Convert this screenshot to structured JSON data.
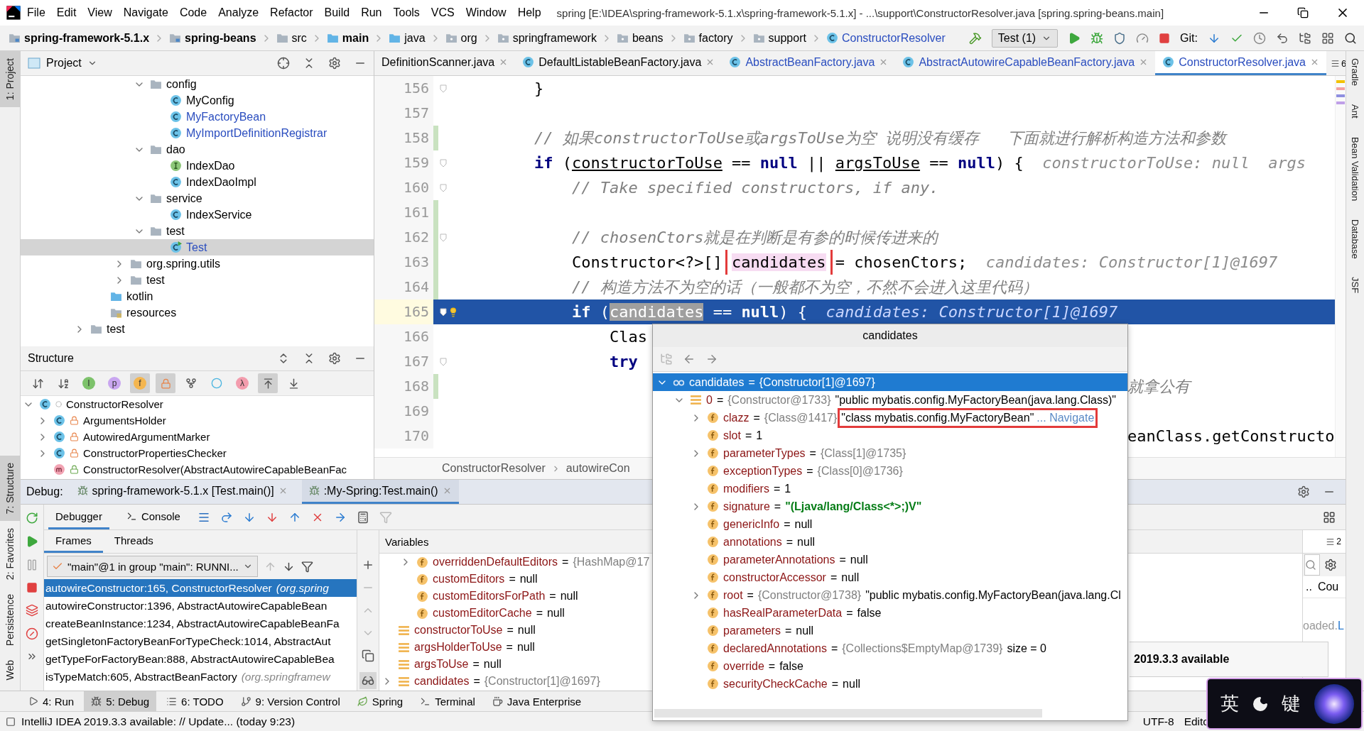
{
  "title_bar": {
    "menu": [
      "File",
      "Edit",
      "View",
      "Navigate",
      "Code",
      "Analyze",
      "Refactor",
      "Build",
      "Run",
      "Tools",
      "VCS",
      "Window",
      "Help"
    ],
    "title": "spring [E:\\IDEA\\spring-framework-5.1.x\\spring-framework-5.1.x] - ...\\support\\ConstructorResolver.java [spring.spring-beans.main]"
  },
  "nav_bar": {
    "path": [
      {
        "label": "spring-framework-5.1.x",
        "kind": "module"
      },
      {
        "label": "spring-beans",
        "kind": "module"
      },
      {
        "label": "src",
        "kind": "folder"
      },
      {
        "label": "main",
        "kind": "source_root"
      },
      {
        "label": "java",
        "kind": "source_folder"
      },
      {
        "label": "org",
        "kind": "package"
      },
      {
        "label": "springframework",
        "kind": "package"
      },
      {
        "label": "beans",
        "kind": "package"
      },
      {
        "label": "factory",
        "kind": "package"
      },
      {
        "label": "support",
        "kind": "package"
      },
      {
        "label": "ConstructorResolver",
        "kind": "class"
      }
    ],
    "run_config": "Test (1)",
    "vcs_label": "Git:"
  },
  "left_tool_strip": [
    {
      "label": "1: Project",
      "selected": true
    },
    {
      "label": "7: Structure",
      "selected": true
    },
    {
      "label": "2: Favorites",
      "selected": false
    },
    {
      "label": "Persistence",
      "selected": false
    },
    {
      "label": "Web",
      "selected": false
    }
  ],
  "right_tool_strip": [
    "Gradle",
    "Ant",
    "Bean Validation",
    "Database",
    "JSF"
  ],
  "project": {
    "title": "Project",
    "tree": [
      {
        "kind": "group",
        "children": [
          {
            "kind": "group",
            "children": [
              {
                "kind": "group",
                "children": [
                  {
                    "label": "config",
                    "kind": "folder",
                    "expanded": true,
                    "selected": false,
                    "color": "#000000",
                    "children": [
                      {
                        "label": "MyConfig",
                        "kind": "class",
                        "selected": false,
                        "color": "#000000"
                      },
                      {
                        "label": "MyFactoryBean",
                        "kind": "class",
                        "selected": false,
                        "color": "#2a4dbf"
                      },
                      {
                        "label": "MyImportDefinitionRegistrar",
                        "kind": "class",
                        "selected": false,
                        "color": "#2a4dbf"
                      }
                    ]
                  },
                  {
                    "label": "dao",
                    "kind": "folder",
                    "expanded": true,
                    "selected": false,
                    "color": "#000000",
                    "children": [
                      {
                        "label": "IndexDao",
                        "kind": "interface",
                        "selected": false,
                        "color": "#000000"
                      },
                      {
                        "label": "IndexDaoImpl",
                        "kind": "class",
                        "selected": false,
                        "color": "#000000"
                      }
                    ]
                  },
                  {
                    "label": "service",
                    "kind": "folder",
                    "expanded": true,
                    "selected": false,
                    "color": "#000000",
                    "children": [
                      {
                        "label": "IndexService",
                        "kind": "class",
                        "selected": false,
                        "color": "#000000"
                      }
                    ]
                  },
                  {
                    "label": "test",
                    "kind": "folder",
                    "expanded": true,
                    "selected": false,
                    "color": "#000000",
                    "children": [
                      {
                        "label": "Test",
                        "kind": "main_class",
                        "selected": true,
                        "color": "#2a4dbf"
                      }
                    ]
                  }
                ]
              },
              {
                "label": "org.spring.utils",
                "kind": "folder",
                "expanded": false,
                "selected": false,
                "color": "#000000"
              },
              {
                "label": "test",
                "kind": "folder",
                "expanded": false,
                "selected": false,
                "color": "#000000"
              }
            ]
          },
          {
            "label": "kotlin",
            "kind": "source_folder",
            "selected": false,
            "color": "#000000"
          },
          {
            "label": "resources",
            "kind": "resource_folder",
            "selected": false,
            "color": "#000000"
          }
        ]
      },
      {
        "label": "test",
        "kind": "folder",
        "expanded": false,
        "selected": false,
        "color": "#000000"
      }
    ]
  },
  "structure": {
    "title": "Structure",
    "toolbar": [
      {
        "kind": "sort_visibility",
        "selected": false
      },
      {
        "kind": "sort_alpha",
        "selected": false
      },
      {
        "kind": "badge",
        "glyph": "I",
        "color": "#7dc26b",
        "selected": false
      },
      {
        "kind": "badge",
        "glyph": "p",
        "color": "#c9a6f0",
        "selected": false
      },
      {
        "kind": "badge",
        "glyph": "f",
        "color": "#f4b650",
        "selected": true
      },
      {
        "kind": "lock",
        "selected": true
      },
      {
        "kind": "fork",
        "selected": false
      },
      {
        "kind": "ring",
        "selected": false
      },
      {
        "kind": "badge",
        "glyph": "λ",
        "color": "#f39cad",
        "selected": false
      },
      {
        "kind": "scroll_to",
        "selected": true
      },
      {
        "kind": "scroll_from",
        "selected": false
      }
    ],
    "tree": [
      {
        "label": "ConstructorResolver",
        "kind": "class",
        "expanded": true,
        "selected": false,
        "children": [
          {
            "label": "ArgumentsHolder",
            "kind": "inner_class",
            "expanded": false,
            "selected": false
          },
          {
            "label": "AutowiredArgumentMarker",
            "kind": "inner_class",
            "expanded": false,
            "selected": false
          },
          {
            "label": "ConstructorPropertiesChecker",
            "kind": "inner_class",
            "expanded": false,
            "selected": false
          },
          {
            "label": "ConstructorResolver(AbstractAutowireCapableBeanFac",
            "kind": "constructor",
            "selected": false
          }
        ]
      }
    ]
  },
  "editor": {
    "tabs": [
      {
        "label": "DefinitionScanner.java",
        "kind": "partial",
        "selected": false,
        "color": "#000000"
      },
      {
        "label": "DefaultListableBeanFactory.java",
        "kind": "file",
        "selected": false,
        "color": "#000000"
      },
      {
        "label": "AbstractBeanFactory.java",
        "kind": "file",
        "selected": false,
        "color": "#2a4dbf"
      },
      {
        "label": "AbstractAutowireCapableBeanFactory.java",
        "kind": "file",
        "selected": false,
        "color": "#2a4dbf"
      },
      {
        "label": "ConstructorResolver.java",
        "kind": "file",
        "selected": true,
        "color": "#2a4dbf"
      }
    ],
    "tab_overflow_count": "6",
    "lines": [
      {
        "number": "156",
        "changed": false,
        "fold": true,
        "current": false,
        "segments": [
          {
            "text": "        }",
            "kind": "plain"
          }
        ]
      },
      {
        "number": "157",
        "changed": false,
        "fold": false,
        "current": false
      },
      {
        "number": "158",
        "changed": true,
        "fold": false,
        "current": false,
        "segments": [
          {
            "text": "        // 如果constructorToUse或argsToUse为空 说明没有缓存   下面就进行解析构造方法和参数",
            "kind": "comment"
          }
        ]
      },
      {
        "number": "159",
        "changed": false,
        "fold": true,
        "current": false,
        "segments": [
          {
            "text": "        if",
            "kind": "keyword"
          },
          {
            "text": " (",
            "kind": "plain"
          },
          {
            "text": "constructorToUse",
            "kind": "var"
          },
          {
            "text": " == ",
            "kind": "plain"
          },
          {
            "text": "null",
            "kind": "keyword"
          },
          {
            "text": " || ",
            "kind": "plain"
          },
          {
            "text": "argsToUse",
            "kind": "var"
          },
          {
            "text": " == ",
            "kind": "plain"
          },
          {
            "text": "null",
            "kind": "keyword"
          },
          {
            "text": ") {",
            "kind": "plain"
          },
          {
            "text": "constructorToUse: null  args",
            "kind": "hint"
          }
        ]
      },
      {
        "number": "160",
        "changed": false,
        "fold": true,
        "current": false,
        "segments": [
          {
            "text": "            // Take specified constructors, if any.",
            "kind": "comment"
          }
        ]
      },
      {
        "number": "161",
        "changed": true,
        "fold": false,
        "current": false
      },
      {
        "number": "162",
        "changed": true,
        "fold": true,
        "current": false,
        "segments": [
          {
            "text": "            // chosenCtors就是在判断是有参的时候传进来的",
            "kind": "comment"
          }
        ]
      },
      {
        "number": "163",
        "changed": true,
        "fold": false,
        "current": false,
        "segments": [
          {
            "text": "            Constructor<?>[] ",
            "kind": "plain"
          },
          {
            "text": "candidates",
            "kind": "boxed"
          },
          {
            "text": " = chosenCtors;",
            "kind": "plain"
          },
          {
            "text": "candidates: Constructor[1]@1697",
            "kind": "hint"
          }
        ]
      },
      {
        "number": "164",
        "changed": true,
        "fold": false,
        "current": false,
        "segments": [
          {
            "text": "            // 构造方法不为空的话（一般都不为空，不然不会进入这里代码）",
            "kind": "comment"
          }
        ]
      },
      {
        "number": "165",
        "changed": false,
        "fold": true,
        "current": true,
        "segments": [
          {
            "text": "            if",
            "kind": "keyword"
          },
          {
            "text": " (",
            "kind": "plain"
          },
          {
            "text": "candidates",
            "kind": "caret_word"
          },
          {
            "text": " == ",
            "kind": "plain"
          },
          {
            "text": "null",
            "kind": "keyword"
          },
          {
            "text": ") {",
            "kind": "plain"
          },
          {
            "text": "candidates: Constructor[1]@1697",
            "kind": "hint"
          }
        ]
      },
      {
        "number": "166",
        "changed": false,
        "fold": false,
        "current": false,
        "segments": [
          {
            "text": "                Clas",
            "kind": "plain"
          }
        ]
      },
      {
        "number": "167",
        "changed": false,
        "fold": true,
        "current": false,
        "segments": [
          {
            "text": "                try",
            "kind": "keyword"
          }
        ]
      },
      {
        "number": "168",
        "changed": true,
        "fold": false,
        "current": false,
        "tail": {
          "text": "就拿公有",
          "kind": "comment"
        }
      },
      {
        "number": "169",
        "changed": false,
        "fold": false,
        "current": false
      },
      {
        "number": "170",
        "changed": false,
        "fold": false,
        "current": false,
        "tail": {
          "text": "eanClass.getConstructo",
          "kind": "plain"
        }
      }
    ],
    "breadcrumb": [
      "ConstructorResolver",
      "autowireCon"
    ]
  },
  "debug": {
    "label": "Debug:",
    "sessions": [
      {
        "label": "spring-framework-5.1.x [Test.main()]",
        "selected": false
      },
      {
        "label": ":My-Spring:Test.main()",
        "selected": true
      }
    ],
    "views": [
      {
        "label": "Debugger",
        "kind": "debugger",
        "selected": true
      },
      {
        "label": "Console",
        "kind": "console",
        "selected": false
      }
    ],
    "frame_tabs": [
      {
        "label": "Frames",
        "selected": true
      },
      {
        "label": "Threads",
        "selected": false
      }
    ],
    "thread": "\"main\"@1 in group \"main\": RUNNI...",
    "frames": [
      {
        "text": "autowireConstructor:165, ConstructorResolver",
        "package": "(org.spring",
        "selected": true
      },
      {
        "text": "autowireConstructor:1396, AbstractAutowireCapableBean",
        "selected": false
      },
      {
        "text": "createBeanInstance:1234, AbstractAutowireCapableBeanFa",
        "selected": false
      },
      {
        "text": "getSingletonFactoryBeanForTypeCheck:1014, AbstractAut",
        "selected": false
      },
      {
        "text": "getTypeForFactoryBean:888, AbstractAutowireCapableBea",
        "selected": false
      },
      {
        "text": "isTypeMatch:605, AbstractBeanFactory",
        "package": "(org.springframew",
        "selected": false
      }
    ],
    "variables_title": "Variables",
    "variables": [
      {
        "kind": "group",
        "children": [
          {
            "kind": "field",
            "name": "overriddenDefaultEditors",
            "op": "=",
            "ref": "{HashMap@17",
            "expanded": false
          },
          {
            "kind": "field",
            "name": "customEditors",
            "op": "=",
            "value": "null"
          },
          {
            "kind": "field",
            "name": "customEditorsForPath",
            "op": "=",
            "value": "null"
          },
          {
            "kind": "field",
            "name": "customEditorCache",
            "op": "=",
            "value": "null"
          }
        ]
      },
      {
        "kind": "local",
        "name": "constructorToUse",
        "op": "=",
        "value": "null"
      },
      {
        "kind": "local",
        "name": "argsHolderToUse",
        "op": "=",
        "value": "null"
      },
      {
        "kind": "local",
        "name": "argsToUse",
        "op": "=",
        "value": "null"
      },
      {
        "kind": "array",
        "name": "candidates",
        "op": "=",
        "ref": "{Constructor[1]@1697}",
        "expanded": false
      }
    ],
    "layout_count": "2",
    "memory": {
      "dots": "..",
      "column": "Cou",
      "note": "oaded.",
      "link": "L"
    },
    "notification": "2019.3.3 available"
  },
  "popup": {
    "title": "candidates",
    "tree": [
      {
        "kind": "watch",
        "name": "candidates",
        "op": "=",
        "ref": "{Constructor[1]@1697}",
        "expanded": true,
        "selected": true,
        "children": [
          {
            "kind": "array",
            "name": "0",
            "op": "=",
            "ref": "{Constructor@1733}",
            "value": "\"public mybatis.config.MyFactoryBean(java.lang.Class)\"",
            "expanded": true,
            "selected": false,
            "children": [
              {
                "kind": "field",
                "name": "clazz",
                "op": "=",
                "ref": "{Class@1417}",
                "value": "\"class mybatis.config.MyFactoryBean\"",
                "link": "... Navigate",
                "boxed": true,
                "expanded": false,
                "selected": false
              },
              {
                "kind": "field",
                "name": "slot",
                "op": "=",
                "value": "1",
                "selected": false
              },
              {
                "kind": "field",
                "name": "parameterTypes",
                "op": "=",
                "ref": "{Class[1]@1735}",
                "expanded": false,
                "selected": false
              },
              {
                "kind": "field",
                "name": "exceptionTypes",
                "op": "=",
                "ref": "{Class[0]@1736}",
                "selected": false
              },
              {
                "kind": "field",
                "name": "modifiers",
                "op": "=",
                "value": "1",
                "selected": false
              },
              {
                "kind": "field",
                "name": "signature",
                "op": "=",
                "value": "\"(Ljava/lang/Class<*>;)V\"",
                "string_value": true,
                "expanded": false,
                "selected": false
              },
              {
                "kind": "field",
                "name": "genericInfo",
                "op": "=",
                "value": "null",
                "selected": false
              },
              {
                "kind": "field",
                "name": "annotations",
                "op": "=",
                "value": "null",
                "selected": false
              },
              {
                "kind": "field",
                "name": "parameterAnnotations",
                "op": "=",
                "value": "null",
                "selected": false
              },
              {
                "kind": "field",
                "name": "constructorAccessor",
                "op": "=",
                "value": "null",
                "selected": false
              },
              {
                "kind": "field",
                "name": "root",
                "op": "=",
                "ref": "{Constructor@1738}",
                "value": "\"public mybatis.config.MyFactoryBean(java.lang.Cl",
                "expanded": false,
                "selected": false
              },
              {
                "kind": "field",
                "name": "hasRealParameterData",
                "op": "=",
                "value": "false",
                "selected": false
              },
              {
                "kind": "field",
                "name": "parameters",
                "op": "=",
                "value": "null",
                "selected": false
              },
              {
                "kind": "field",
                "name": "declaredAnnotations",
                "op": "=",
                "ref": "{Collections$EmptyMap@1739}",
                "value": "size = 0",
                "selected": false
              },
              {
                "kind": "field",
                "name": "override",
                "op": "=",
                "value": "false",
                "selected": false
              },
              {
                "kind": "field",
                "name": "securityCheckCache",
                "op": "=",
                "value": "null",
                "selected": false
              }
            ]
          }
        ]
      }
    ]
  },
  "bottom_tabs": [
    {
      "label": "4: Run",
      "kind": "run",
      "selected": false
    },
    {
      "label": "5: Debug",
      "kind": "debug",
      "selected": true
    },
    {
      "label": "6: TODO",
      "kind": "todo",
      "selected": false
    },
    {
      "label": "9: Version Control",
      "kind": "vcs",
      "selected": false
    },
    {
      "label": "Spring",
      "kind": "spring",
      "selected": false
    },
    {
      "label": "Terminal",
      "kind": "terminal",
      "selected": false
    },
    {
      "label": "Java Enterprise",
      "kind": "javaee",
      "selected": false
    }
  ],
  "status_bar": {
    "message": "IntelliJ IDEA 2019.3.3 available: // Update... (today 9:23)",
    "encoding": "UTF-8",
    "editor_config": "Edito"
  },
  "ime_bar": [
    "英",
    "键"
  ]
}
